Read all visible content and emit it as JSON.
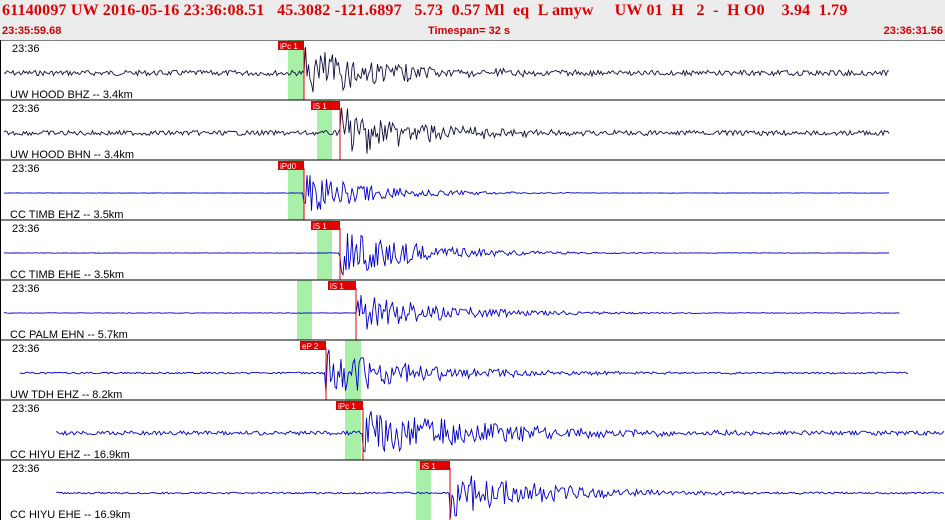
{
  "header": {
    "title": "61140097 UW 2016-05-16 23:36:08.51   45.3082 -121.6897   5.73  0.57 Ml  eq  L amyw     UW 01  H   2  -  H O0    3.94  1.79",
    "time_start": "23:35:59.68",
    "timespan": "Timespan=  32 s",
    "time_end": "23:36:31.56"
  },
  "colors": {
    "header_text": "#e00000",
    "highlight": "#a8f0a8",
    "pick": "#e00000",
    "trace_hood": "#101040",
    "trace_other": "#0000c8"
  },
  "traces": [
    {
      "time_label": "23:36",
      "station": "UW HOOD BHZ -- 3.4km",
      "pick": "iPc 1",
      "color": "#101040",
      "noise": 0.45,
      "onset": 0.34,
      "amp": 1.0,
      "decay": 0.25
    },
    {
      "time_label": "23:36",
      "station": "UW HOOD BHN -- 3.4km",
      "pick": "iS 1",
      "color": "#101040",
      "noise": 0.4,
      "onset": 0.36,
      "amp": 1.0,
      "decay": 0.25
    },
    {
      "time_label": "23:36",
      "station": "CC TIMB EHZ -- 3.5km",
      "pick": "iPd0",
      "color": "#0000c8",
      "noise": 0.03,
      "onset": 0.345,
      "amp": 0.8,
      "decay": 0.22
    },
    {
      "time_label": "23:36",
      "station": "CC TIMB EHE -- 3.5km",
      "pick": "iS 1",
      "color": "#0000c8",
      "noise": 0.04,
      "onset": 0.38,
      "amp": 0.9,
      "decay": 0.25
    },
    {
      "time_label": "23:36",
      "station": "CC PALM EHN -- 5.7km",
      "pick": "iS 1",
      "color": "#0000c8",
      "noise": 0.05,
      "onset": 0.4,
      "amp": 0.7,
      "decay": 0.3
    },
    {
      "time_label": "23:36",
      "station": "UW TDH EHZ -- 8.2km",
      "pick": "eP 2",
      "color": "#0000c8",
      "noise": 0.15,
      "onset": 0.4,
      "amp": 0.9,
      "decay": 0.3
    },
    {
      "time_label": "23:36",
      "station": "CC HIYU EHZ -- 16.9km",
      "pick": "iPc 1",
      "color": "#0000c8",
      "noise": 0.35,
      "onset": 0.41,
      "amp": 0.9,
      "decay": 0.4
    },
    {
      "time_label": "23:36",
      "station": "CC HIYU EHE -- 16.9km",
      "pick": "iS 1",
      "color": "#0000c8",
      "noise": 0.15,
      "onset": 0.48,
      "amp": 0.9,
      "decay": 0.3
    }
  ]
}
